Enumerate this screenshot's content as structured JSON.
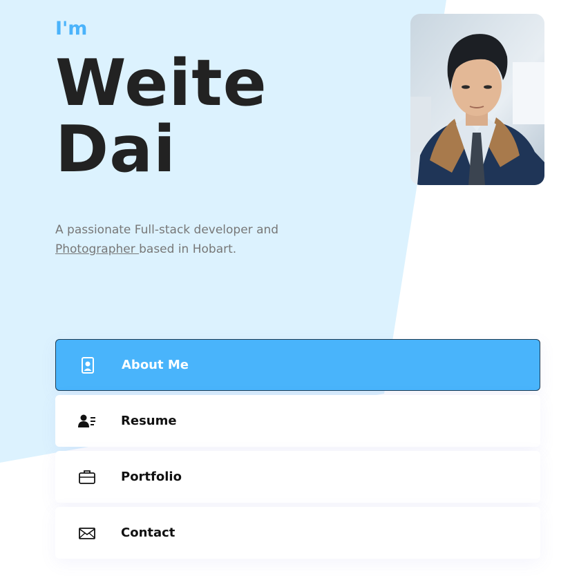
{
  "colors": {
    "accent": "#4ab3fb",
    "hero_background": "#dcf2fe",
    "active_item": "#49b4fb",
    "heading": "#222222",
    "body_text": "#777777"
  },
  "hero": {
    "intro": "I'm",
    "first_name": "Weite",
    "last_name": "Dai",
    "tagline_line1": "A passionate Full-stack developer and",
    "tagline_link": "Photographer ",
    "tagline_line2_rest": "based in Hobart."
  },
  "profile_photo": {
    "icon": "profile-photo"
  },
  "menu": {
    "items": [
      {
        "label": "About Me",
        "icon": "id-badge-icon",
        "active": true
      },
      {
        "label": "Resume",
        "icon": "user-list-icon",
        "active": false
      },
      {
        "label": "Portfolio",
        "icon": "briefcase-icon",
        "active": false
      },
      {
        "label": "Contact",
        "icon": "envelope-icon",
        "active": false
      }
    ]
  }
}
